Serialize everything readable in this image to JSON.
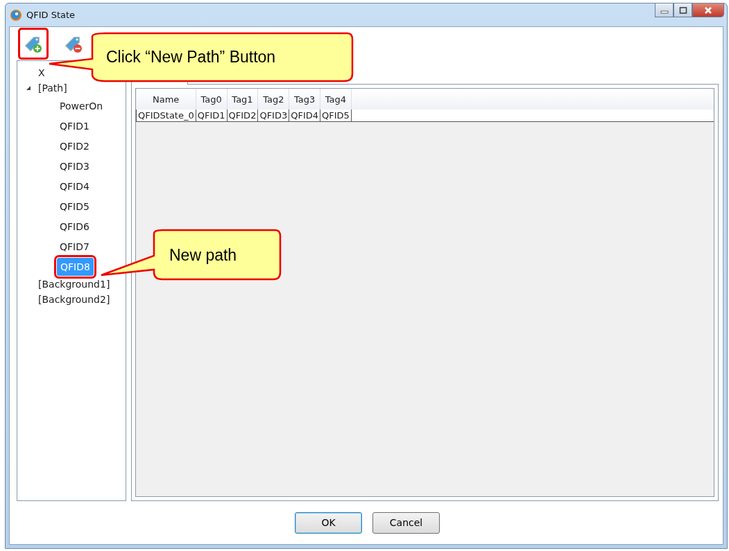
{
  "window": {
    "title": "QFID State"
  },
  "toolbar": [
    {
      "kind": "add",
      "highlighted": true
    },
    {
      "kind": "remove",
      "highlighted": false
    }
  ],
  "tree": [
    {
      "label": "X",
      "selected": false,
      "highlighted": false
    },
    {
      "label": "[Path]",
      "selected": false,
      "expanded": true,
      "highlighted": false,
      "children": [
        {
          "label": "PowerOn",
          "selected": false,
          "highlighted": false
        },
        {
          "label": "QFID1",
          "selected": false,
          "highlighted": false
        },
        {
          "label": "QFID2",
          "selected": false,
          "highlighted": false
        },
        {
          "label": "QFID3",
          "selected": false,
          "highlighted": false
        },
        {
          "label": "QFID4",
          "selected": false,
          "highlighted": false
        },
        {
          "label": "QFID5",
          "selected": false,
          "highlighted": false
        },
        {
          "label": "QFID6",
          "selected": false,
          "highlighted": false
        },
        {
          "label": "QFID7",
          "selected": false,
          "highlighted": false
        },
        {
          "label": "QFID8",
          "selected": true,
          "highlighted": true
        }
      ]
    },
    {
      "label": "[Background1]",
      "selected": false,
      "highlighted": false
    },
    {
      "label": "[Background2]",
      "selected": false,
      "highlighted": false
    }
  ],
  "table": {
    "columns": [
      "Name",
      "Tag0",
      "Tag1",
      "Tag2",
      "Tag3",
      "Tag4"
    ],
    "rows": [
      [
        "QFIDState_0",
        "QFID1",
        "QFID2",
        "QFID3",
        "QFID4",
        "QFID5"
      ]
    ]
  },
  "buttons": [
    {
      "label": "OK",
      "default": true
    },
    {
      "label": "Cancel",
      "default": false
    }
  ],
  "callouts": [
    {
      "text": "Click “New Path” Button"
    },
    {
      "text": "New path"
    }
  ]
}
